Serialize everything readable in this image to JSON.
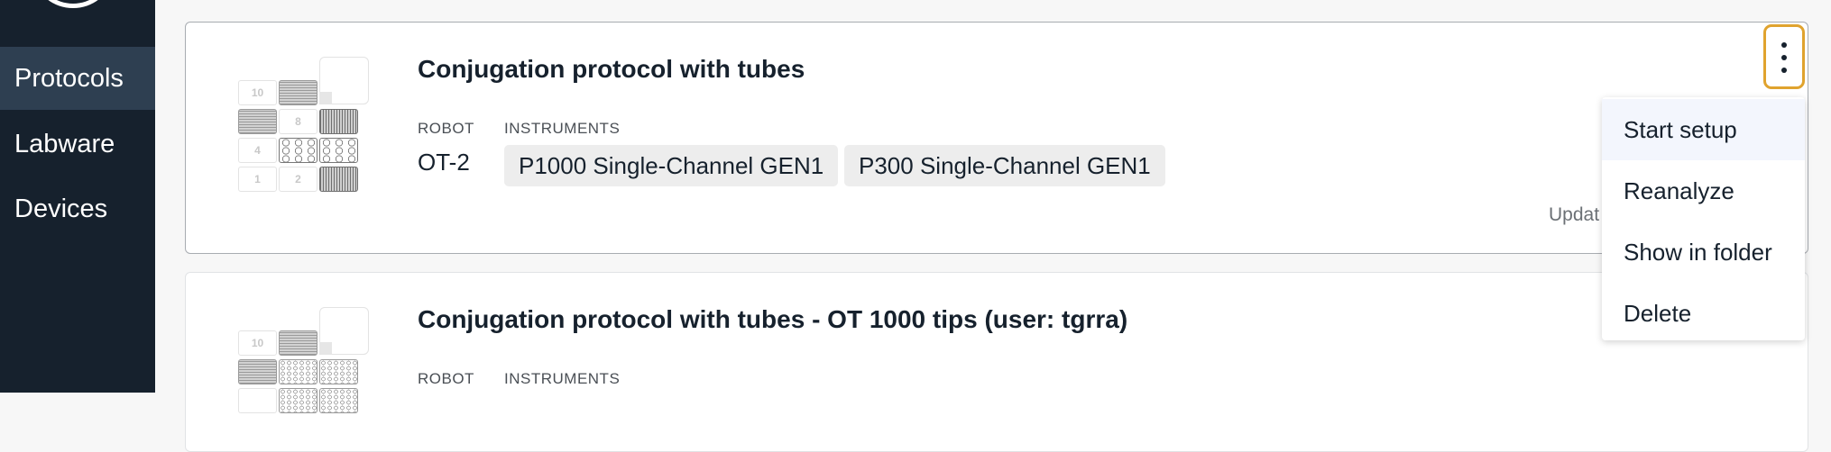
{
  "sidebar": {
    "items": [
      {
        "label": "Protocols",
        "active": true
      },
      {
        "label": "Labware",
        "active": false
      },
      {
        "label": "Devices",
        "active": false
      }
    ]
  },
  "protocols": [
    {
      "title": "Conjugation protocol with tubes",
      "robot_label": "ROBOT",
      "robot": "OT-2",
      "instruments_label": "INSTRUMENTS",
      "instruments": [
        "P1000 Single-Channel GEN1",
        "P300 Single-Channel GEN1"
      ],
      "updated": "Updat",
      "deck_slots": [
        "10",
        "8",
        "4",
        "1",
        "2"
      ]
    },
    {
      "title": "Conjugation protocol with tubes - OT 1000 tips (user: tgrra)",
      "robot_label": "ROBOT",
      "instruments_label": "INSTRUMENTS",
      "deck_slots": [
        "10"
      ]
    }
  ],
  "overflow_menu": {
    "items": [
      "Start setup",
      "Reanalyze",
      "Show in folder",
      "Delete"
    ],
    "highlighted": "Start setup"
  },
  "colors": {
    "sidebar_bg": "#16212d",
    "sidebar_active": "#2e3f51",
    "focus_outline": "#e0a32e",
    "chip_bg": "#ededed"
  }
}
